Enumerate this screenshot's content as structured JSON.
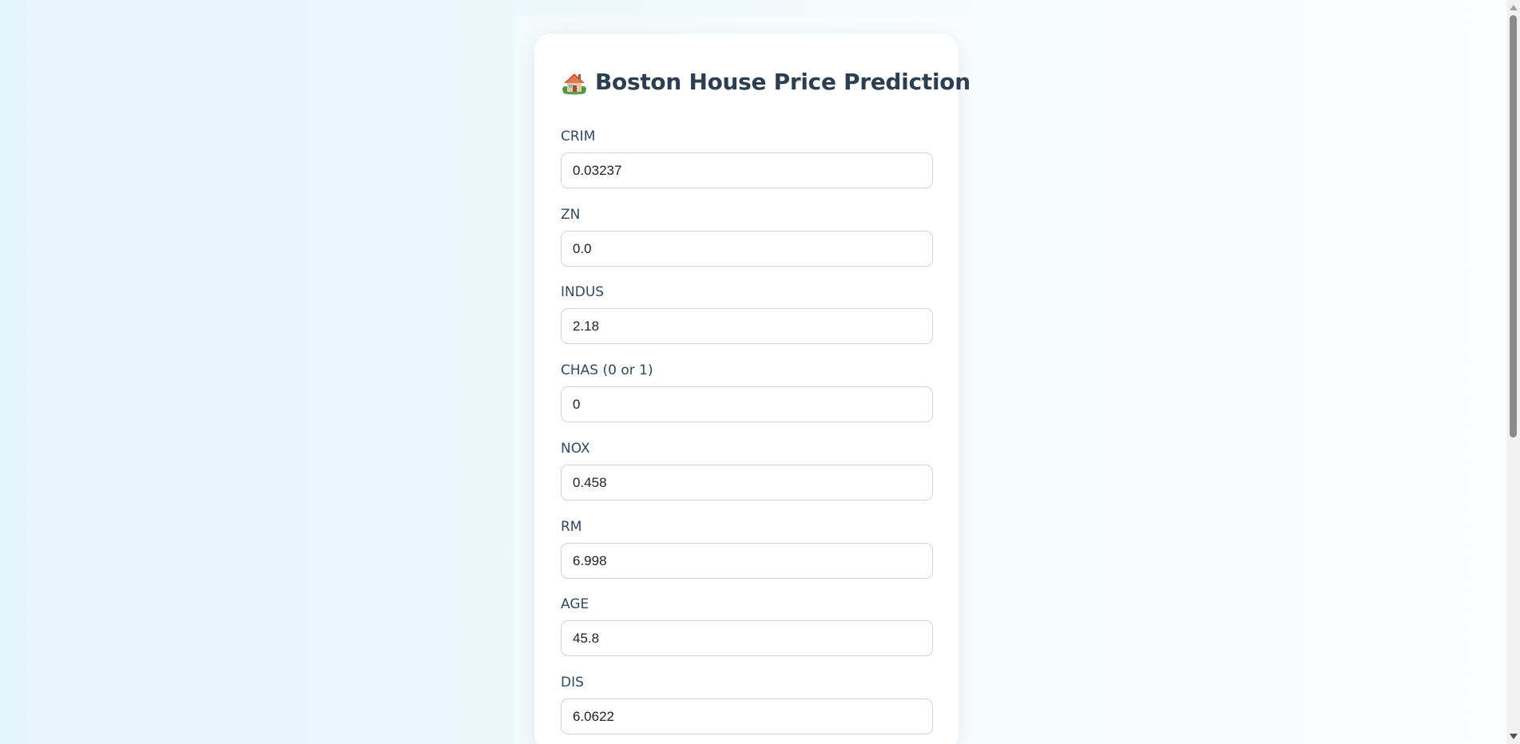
{
  "page": {
    "title": "Boston House Price Prediction",
    "title_icon": "house-with-garden-icon"
  },
  "form": {
    "fields": [
      {
        "name": "crim",
        "label": "CRIM",
        "value": "0.03237"
      },
      {
        "name": "zn",
        "label": "ZN",
        "value": "0.0"
      },
      {
        "name": "indus",
        "label": "INDUS",
        "value": "2.18"
      },
      {
        "name": "chas",
        "label": "CHAS (0 or 1)",
        "value": "0"
      },
      {
        "name": "nox",
        "label": "NOX",
        "value": "0.458"
      },
      {
        "name": "rm",
        "label": "RM",
        "value": "6.998"
      },
      {
        "name": "age",
        "label": "AGE",
        "value": "45.8"
      },
      {
        "name": "dis",
        "label": "DIS",
        "value": "6.0622"
      }
    ]
  },
  "colors": {
    "title": "#2c3e50",
    "label": "#34495e",
    "input_border": "#cfd4d8",
    "background_left": "#e3f4f9",
    "background_right": "#fbfdfe"
  }
}
